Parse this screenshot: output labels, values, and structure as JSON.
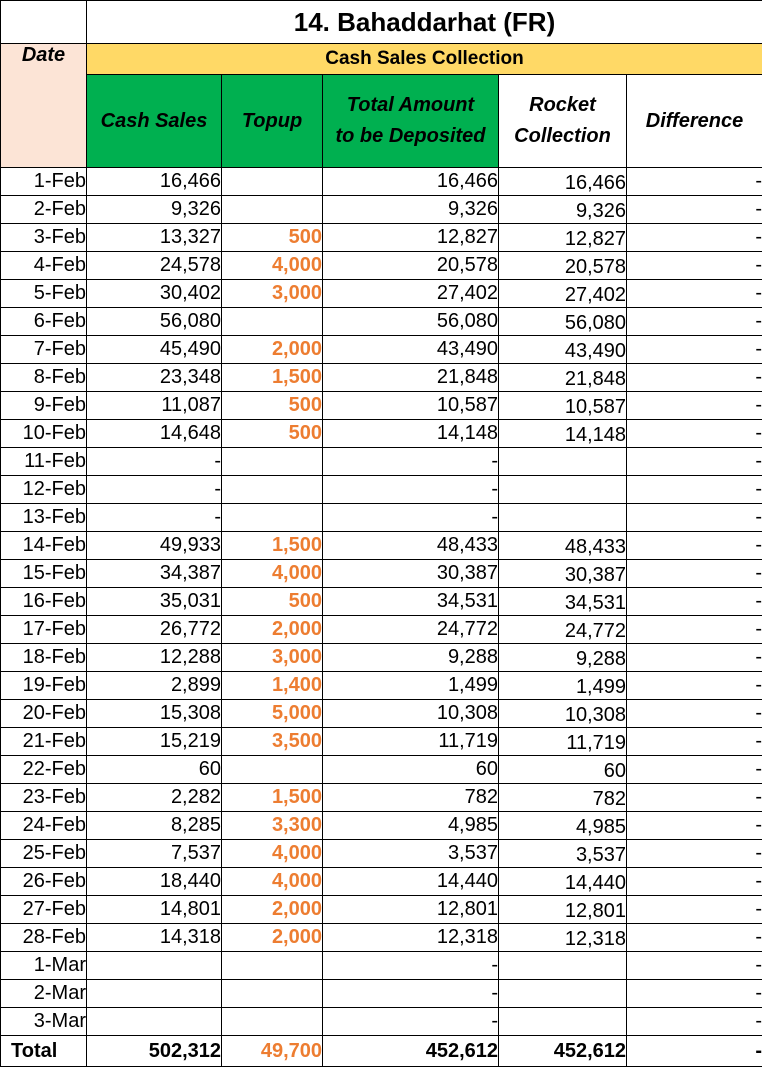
{
  "title": "14. Bahaddarhat (FR)",
  "subheader": "Cash Sales Collection",
  "headers": {
    "date": "Date",
    "cash_sales": "Cash Sales",
    "topup": "Topup",
    "total_amount_line1": "Total Amount",
    "total_amount_line2": "to be Deposited",
    "rocket_line1": "Rocket",
    "rocket_line2": "Collection",
    "difference": "Difference"
  },
  "colors": {
    "header_green": "#00B050",
    "subheader_yellow": "#FFD966",
    "date_header_peach": "#FCE4D6",
    "topup_orange": "#ED7D31"
  },
  "rows": [
    {
      "date": "1-Feb",
      "cash": "16,466",
      "topup": "",
      "total": "16,466",
      "rocket": "16,466",
      "diff": "-"
    },
    {
      "date": "2-Feb",
      "cash": "9,326",
      "topup": "",
      "total": "9,326",
      "rocket": "9,326",
      "diff": "-"
    },
    {
      "date": "3-Feb",
      "cash": "13,327",
      "topup": "500",
      "total": "12,827",
      "rocket": "12,827",
      "diff": "-"
    },
    {
      "date": "4-Feb",
      "cash": "24,578",
      "topup": "4,000",
      "total": "20,578",
      "rocket": "20,578",
      "diff": "-"
    },
    {
      "date": "5-Feb",
      "cash": "30,402",
      "topup": "3,000",
      "total": "27,402",
      "rocket": "27,402",
      "diff": "-"
    },
    {
      "date": "6-Feb",
      "cash": "56,080",
      "topup": "",
      "total": "56,080",
      "rocket": "56,080",
      "diff": "-"
    },
    {
      "date": "7-Feb",
      "cash": "45,490",
      "topup": "2,000",
      "total": "43,490",
      "rocket": "43,490",
      "diff": "-"
    },
    {
      "date": "8-Feb",
      "cash": "23,348",
      "topup": "1,500",
      "total": "21,848",
      "rocket": "21,848",
      "diff": "-"
    },
    {
      "date": "9-Feb",
      "cash": "11,087",
      "topup": "500",
      "total": "10,587",
      "rocket": "10,587",
      "diff": "-"
    },
    {
      "date": "10-Feb",
      "cash": "14,648",
      "topup": "500",
      "total": "14,148",
      "rocket": "14,148",
      "diff": "-"
    },
    {
      "date": "11-Feb",
      "cash": "-",
      "topup": "",
      "total": "-",
      "rocket": "",
      "diff": "-"
    },
    {
      "date": "12-Feb",
      "cash": "-",
      "topup": "",
      "total": "-",
      "rocket": "",
      "diff": "-"
    },
    {
      "date": "13-Feb",
      "cash": "-",
      "topup": "",
      "total": "-",
      "rocket": "",
      "diff": "-"
    },
    {
      "date": "14-Feb",
      "cash": "49,933",
      "topup": "1,500",
      "total": "48,433",
      "rocket": "48,433",
      "diff": "-"
    },
    {
      "date": "15-Feb",
      "cash": "34,387",
      "topup": "4,000",
      "total": "30,387",
      "rocket": "30,387",
      "diff": "-"
    },
    {
      "date": "16-Feb",
      "cash": "35,031",
      "topup": "500",
      "total": "34,531",
      "rocket": "34,531",
      "diff": "-"
    },
    {
      "date": "17-Feb",
      "cash": "26,772",
      "topup": "2,000",
      "total": "24,772",
      "rocket": "24,772",
      "diff": "-"
    },
    {
      "date": "18-Feb",
      "cash": "12,288",
      "topup": "3,000",
      "total": "9,288",
      "rocket": "9,288",
      "diff": "-"
    },
    {
      "date": "19-Feb",
      "cash": "2,899",
      "topup": "1,400",
      "total": "1,499",
      "rocket": "1,499",
      "diff": "-"
    },
    {
      "date": "20-Feb",
      "cash": "15,308",
      "topup": "5,000",
      "total": "10,308",
      "rocket": "10,308",
      "diff": "-"
    },
    {
      "date": "21-Feb",
      "cash": "15,219",
      "topup": "3,500",
      "total": "11,719",
      "rocket": "11,719",
      "diff": "-"
    },
    {
      "date": "22-Feb",
      "cash": "60",
      "topup": "",
      "total": "60",
      "rocket": "60",
      "diff": "-"
    },
    {
      "date": "23-Feb",
      "cash": "2,282",
      "topup": "1,500",
      "total": "782",
      "rocket": "782",
      "diff": "-"
    },
    {
      "date": "24-Feb",
      "cash": "8,285",
      "topup": "3,300",
      "total": "4,985",
      "rocket": "4,985",
      "diff": "-"
    },
    {
      "date": "25-Feb",
      "cash": "7,537",
      "topup": "4,000",
      "total": "3,537",
      "rocket": "3,537",
      "diff": "-"
    },
    {
      "date": "26-Feb",
      "cash": "18,440",
      "topup": "4,000",
      "total": "14,440",
      "rocket": "14,440",
      "diff": "-"
    },
    {
      "date": "27-Feb",
      "cash": "14,801",
      "topup": "2,000",
      "total": "12,801",
      "rocket": "12,801",
      "diff": "-"
    },
    {
      "date": "28-Feb",
      "cash": "14,318",
      "topup": "2,000",
      "total": "12,318",
      "rocket": "12,318",
      "diff": "-"
    },
    {
      "date": "1-Mar",
      "cash": "",
      "topup": "",
      "total": "-",
      "rocket": "",
      "diff": "-"
    },
    {
      "date": "2-Mar",
      "cash": "",
      "topup": "",
      "total": "-",
      "rocket": "",
      "diff": "-"
    },
    {
      "date": "3-Mar",
      "cash": "",
      "topup": "",
      "total": "-",
      "rocket": "",
      "diff": "-"
    }
  ],
  "totals": {
    "label": "Total",
    "cash": "502,312",
    "topup": "49,700",
    "total": "452,612",
    "rocket": "452,612",
    "diff": "-"
  }
}
